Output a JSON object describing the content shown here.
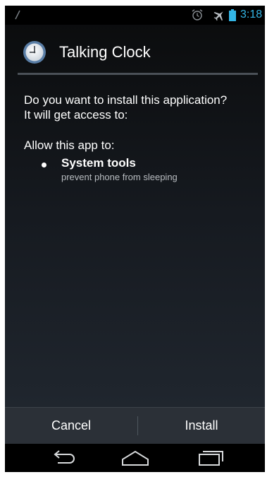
{
  "status_bar": {
    "time": "3:18",
    "icons": [
      "signal-slash-icon",
      "alarm-icon",
      "airplane-icon",
      "battery-icon"
    ],
    "time_color": "#33b5e5"
  },
  "header": {
    "app_name": "Talking Clock",
    "icon": "clock-icon"
  },
  "install_prompt": {
    "line1": "Do you want to install this application?",
    "line2": "It will get access to:"
  },
  "permissions": {
    "heading": "Allow this app to:",
    "items": [
      {
        "name": "System tools",
        "description": "prevent phone from sleeping"
      }
    ]
  },
  "actions": {
    "cancel_label": "Cancel",
    "install_label": "Install"
  },
  "navigation": {
    "buttons": [
      "back-icon",
      "home-icon",
      "recent-apps-icon"
    ]
  }
}
